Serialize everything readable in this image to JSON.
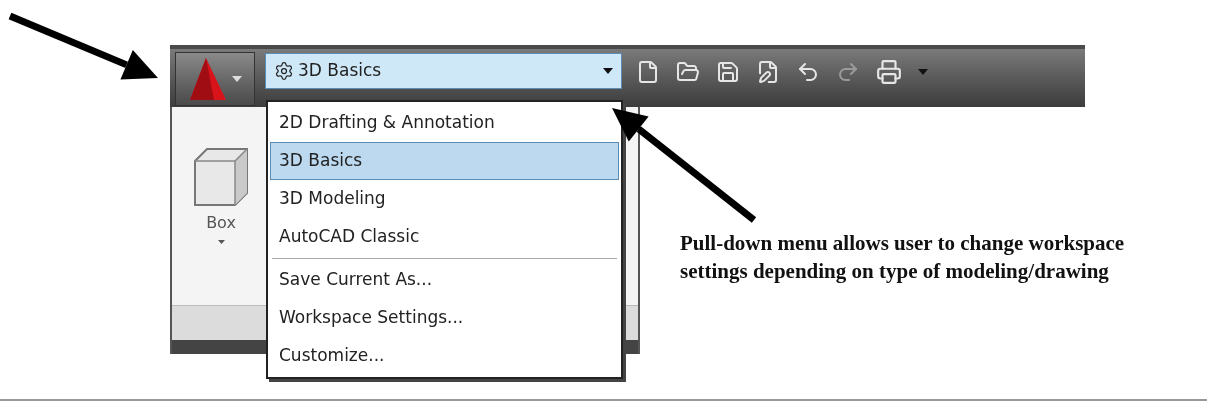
{
  "workspace_switcher": {
    "value": "3D Basics",
    "expanded": true
  },
  "workspace_menu": {
    "workspaces": [
      {
        "label": "2D Drafting & Annotation",
        "selected": false
      },
      {
        "label": "3D Basics",
        "selected": true
      },
      {
        "label": "3D Modeling",
        "selected": false
      },
      {
        "label": "AutoCAD Classic",
        "selected": false
      }
    ],
    "commands": [
      {
        "label": "Save Current As..."
      },
      {
        "label": "Workspace Settings..."
      },
      {
        "label": "Customize..."
      }
    ]
  },
  "ribbon": {
    "tool_label": "Box"
  },
  "annotation": "Pull-down menu allows user to change workspace settings depending on type of modeling/drawing"
}
